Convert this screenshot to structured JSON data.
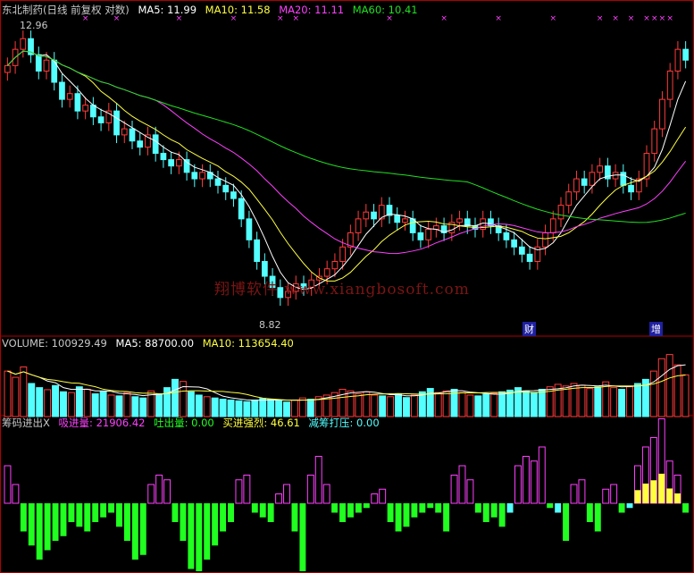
{
  "colors": {
    "up": "#ff3b3b",
    "down": "#54ffff",
    "ma5": "#ffffff",
    "ma10": "#ffff40",
    "ma20": "#ff40ff",
    "ma60": "#20e020",
    "label": "#c8c8c8",
    "border": "#b00000",
    "absorb": "#ff40ff",
    "spit": "#20ff20",
    "strong": "#ffff40",
    "reduce": "#54ffff"
  },
  "price_header": {
    "title": "东北制药(日线 前复权 对数)",
    "ma5": "MA5: 11.99",
    "ma10": "MA10: 11.58",
    "ma20": "MA20: 11.11",
    "ma60": "MA60: 10.41"
  },
  "annotations": {
    "high": "12.96",
    "low": "8.82",
    "marker_cai": "财",
    "marker_zeng": "增"
  },
  "watermark": "翔博软件 www.xiangbosoft.com",
  "volume_header": {
    "label": "VOLUME: 100929.49",
    "ma5": "MA5: 88700.00",
    "ma10": "MA10: 113654.40"
  },
  "indicator_header": {
    "name": "筹码进出X",
    "absorb": "吸进量: 21906.42",
    "spit": "吐出量: 0.00",
    "strong": "买进强烈: 46.61",
    "reduce": "减筹打压: 0.00"
  },
  "chart_data": [
    {
      "type": "candlestick",
      "title": "东北制药(日线 前复权 对数)",
      "ylim": [
        8.4,
        13.3
      ],
      "y_scale": "log",
      "series_close": [
        12.4,
        12.7,
        12.9,
        12.6,
        12.3,
        12.5,
        12.1,
        11.8,
        11.9,
        11.6,
        11.7,
        11.5,
        11.4,
        11.6,
        11.2,
        11.3,
        11.1,
        11.0,
        11.2,
        10.9,
        10.8,
        10.7,
        10.8,
        10.6,
        10.5,
        10.6,
        10.5,
        10.4,
        10.3,
        10.2,
        9.9,
        9.6,
        9.3,
        9.1,
        8.95,
        8.82,
        8.9,
        9.0,
        8.95,
        9.05,
        9.1,
        9.2,
        9.3,
        9.5,
        9.7,
        9.9,
        10.0,
        9.9,
        10.1,
        9.95,
        9.85,
        9.9,
        9.7,
        9.6,
        9.75,
        9.8,
        9.7,
        9.85,
        9.9,
        9.8,
        9.75,
        9.9,
        9.8,
        9.7,
        9.6,
        9.5,
        9.4,
        9.3,
        9.5,
        9.7,
        9.9,
        10.1,
        10.3,
        10.5,
        10.4,
        10.6,
        10.7,
        10.5,
        10.6,
        10.4,
        10.3,
        10.5,
        10.9,
        11.3,
        11.8,
        12.3,
        12.7,
        12.5
      ],
      "markers": [
        {
          "label": "财",
          "date_index": 65
        },
        {
          "label": "增",
          "date_index": 83
        }
      ],
      "annotations": [
        {
          "text": "12.96",
          "kind": "high"
        },
        {
          "text": "8.82",
          "kind": "low"
        }
      ],
      "ma_values": {
        "MA5": 11.99,
        "MA10": 11.58,
        "MA20": 11.11,
        "MA60": 10.41
      }
    },
    {
      "type": "bar",
      "title": "VOLUME",
      "ylim": [
        0,
        160000
      ],
      "values": [
        110000,
        95000,
        120000,
        80000,
        70000,
        65000,
        75000,
        60000,
        58000,
        72000,
        66000,
        55000,
        60000,
        52000,
        50000,
        58000,
        48000,
        45000,
        62000,
        55000,
        70000,
        90000,
        85000,
        60000,
        52000,
        48000,
        45000,
        42000,
        40000,
        38000,
        36000,
        40000,
        44000,
        42000,
        38000,
        35000,
        40000,
        45000,
        42000,
        48000,
        52000,
        58000,
        66000,
        62000,
        55000,
        60000,
        52000,
        50000,
        48000,
        55000,
        46000,
        52000,
        60000,
        68000,
        58000,
        62000,
        66000,
        58000,
        52000,
        50000,
        54000,
        56000,
        60000,
        64000,
        70000,
        62000,
        58000,
        66000,
        72000,
        78000,
        74000,
        80000,
        76000,
        68000,
        72000,
        84000,
        70000,
        66000,
        72000,
        80000,
        90000,
        110000,
        140000,
        150000,
        125000,
        100929
      ],
      "ma5": 88700,
      "ma10": 113654.4
    },
    {
      "type": "bar",
      "title": "筹码进出X",
      "values": [
        40,
        20,
        -30,
        -45,
        -60,
        -50,
        -40,
        -35,
        -20,
        -25,
        -30,
        -20,
        -15,
        -10,
        -25,
        -40,
        -60,
        -55,
        20,
        30,
        25,
        -20,
        -40,
        -70,
        -80,
        -60,
        -45,
        -30,
        -20,
        25,
        30,
        -10,
        -15,
        -20,
        10,
        20,
        -30,
        -80,
        30,
        50,
        20,
        -10,
        -20,
        -15,
        -10,
        -5,
        10,
        15,
        -20,
        -30,
        -25,
        -15,
        -10,
        -5,
        -10,
        -30,
        30,
        40,
        25,
        -10,
        -20,
        -15,
        -25,
        -10,
        40,
        50,
        45,
        60,
        -5,
        -10,
        -40,
        20,
        25,
        -20,
        -30,
        15,
        20,
        -10,
        -5,
        40,
        60,
        70,
        90,
        45,
        30,
        -10
      ],
      "legend": [
        "吸进量",
        "吐出量",
        "买进强烈",
        "减筹打压"
      ],
      "values_header": {
        "吸进量": 21906.42,
        "吐出量": 0.0,
        "买进强烈": 46.61,
        "减筹打压": 0.0
      }
    }
  ]
}
